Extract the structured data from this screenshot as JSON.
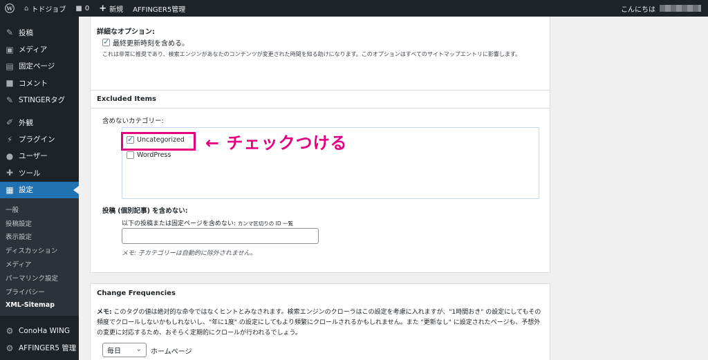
{
  "adminbar": {
    "site_name": "トドジョブ",
    "comments_count": "0",
    "new_label": "新規",
    "affinger_label": "AFFINGER5管理",
    "greeting": "こんにちは"
  },
  "sidebar": {
    "items": [
      {
        "label": "投稿",
        "icon": "pin-icon"
      },
      {
        "label": "メディア",
        "icon": "media-icon"
      },
      {
        "label": "固定ページ",
        "icon": "page-icon"
      },
      {
        "label": "コメント",
        "icon": "comment-icon"
      },
      {
        "label": "STINGERタグ",
        "icon": "pin-icon"
      },
      {
        "label": "外観",
        "icon": "brush-icon"
      },
      {
        "label": "プラグイン",
        "icon": "plugin-icon"
      },
      {
        "label": "ユーザー",
        "icon": "user-icon"
      },
      {
        "label": "ツール",
        "icon": "wrench-icon"
      },
      {
        "label": "設定",
        "icon": "settings-icon"
      }
    ],
    "submenu": [
      "一般",
      "投稿設定",
      "表示設定",
      "ディスカッション",
      "メディア",
      "パーマリンク設定",
      "プライバシー",
      "XML-Sitemap"
    ],
    "bottom_items": [
      {
        "label": "ConoHa WING",
        "icon": "gear-icon"
      },
      {
        "label": "AFFINGER5 管理",
        "icon": "gear-icon"
      }
    ]
  },
  "options_panel": {
    "title": "詳細なオプション:",
    "checkbox_label": "最終更新時刻を含める。",
    "note": "これは非常に推奨であり、検索エンジンがあなたのコンテンツが変更された時間を知る助けになります。このオプションはすべてのサイトマップエントリに影響します。"
  },
  "excluded_panel": {
    "header": "Excluded Items",
    "categories_label": "含めないカテゴリー:",
    "categories": [
      {
        "name": "Uncategorized",
        "checked": true
      },
      {
        "name": "WordPress",
        "checked": false
      }
    ],
    "annotation": "← チェックつける",
    "posts_label": "投稿 (個別記事) を含めない:",
    "posts_sublabel": "以下の投稿または固定ページを含めない:",
    "posts_sublabel_small": "カンマ区切りの ID 一覧",
    "posts_value": "",
    "hint": "メモ: 子カテゴリーは自動的に除外されません。"
  },
  "freq_panel": {
    "header": "Change Frequencies",
    "note_bold": "メモ:",
    "note": " このタグの値は絶対的な命令ではなくヒントとみなされます。検索エンジンのクローラはこの設定を考慮に入れますが、\"1時間おき\" の設定にしてもその頻度でクロールしないかもしれないし、\"年に1度\" の設定にしてもより頻繁にクロールされるかもしれません。また \"更新なし\" に設定されたページも、予想外の変更に対応するため、おそらく定期的にクロールが行われるでしょう。",
    "select_value": "毎日",
    "select_label": "ホームページ"
  },
  "colors": {
    "accent": "#2271b1",
    "annotation": "#e4007f",
    "adminbar": "#1d2327"
  }
}
